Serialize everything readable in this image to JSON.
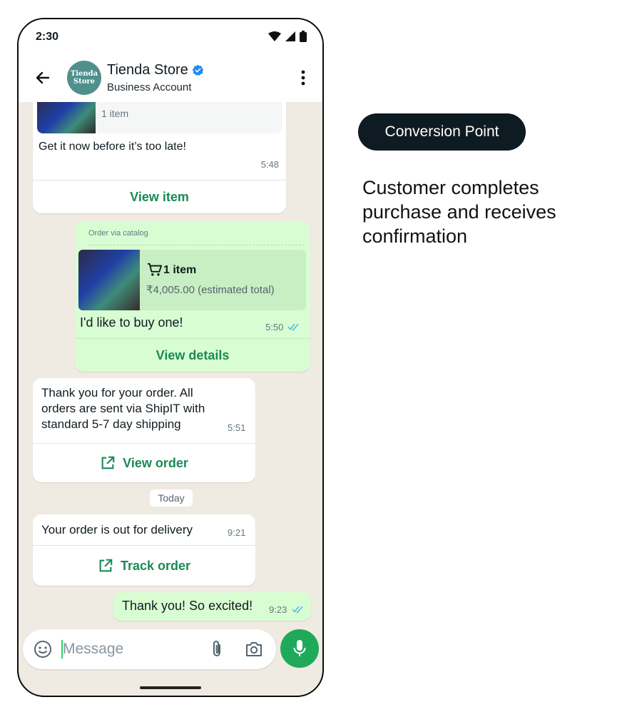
{
  "status": {
    "time": "2:30"
  },
  "header": {
    "avatar_line1": "Tienda",
    "avatar_line2": "Store",
    "name": "Tienda Store",
    "subtitle": "Business Account",
    "verified_icon": "verified-badge-icon"
  },
  "messages": {
    "m1": {
      "item_count": "1 item",
      "text": "Get it now before it’s too late!",
      "time": "5:48",
      "action": "View item"
    },
    "m2": {
      "label": "Order via catalog",
      "item_count": "1 item",
      "price": "₹4,005.00 (estimated total)",
      "text": "I'd like to buy one!",
      "time": "5:50",
      "action": "View details"
    },
    "m3": {
      "text": "Thank you for your order. All orders are sent via ShipIT with standard 5-7 day shipping",
      "time": "5:51",
      "action": "View order"
    },
    "date_divider": "Today",
    "m4": {
      "text": "Your order is out for delivery",
      "time": "9:21",
      "action": "Track order"
    },
    "m5": {
      "text": "Thank you! So excited!",
      "time": "9:23"
    }
  },
  "composer": {
    "placeholder": "Message"
  },
  "side": {
    "pill": "Conversion Point",
    "description": "Customer completes purchase and receives confirmation"
  },
  "colors": {
    "accent_green": "#1a8a55",
    "outgoing_bubble": "#d9fdd3",
    "chat_bg": "#efeae2",
    "pill_bg": "#0f1b22"
  }
}
